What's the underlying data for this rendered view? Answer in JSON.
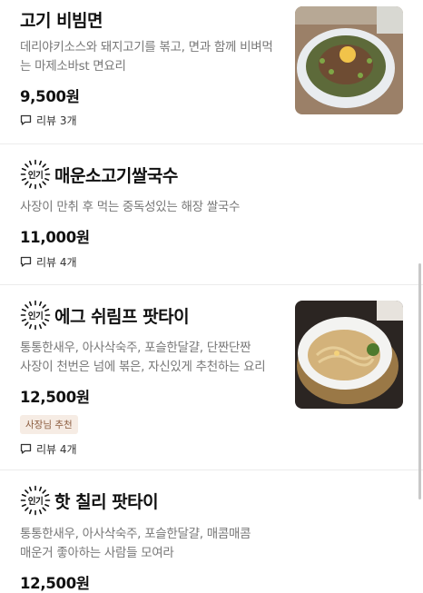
{
  "menu": [
    {
      "name": "고기 비빔면",
      "desc": [
        "데리야키소스와 돼지고기를 볶고, 면과 함께 비벼먹",
        "는 마제소바st 면요리"
      ],
      "price": "9,500원",
      "review": "리뷰 3개"
    },
    {
      "hot_badge": "인기",
      "name": "매운소고기쌀국수",
      "desc": [
        "사장이 만취 후 먹는 중독성있는 해장 쌀국수"
      ],
      "price": "11,000원",
      "review": "리뷰 4개"
    },
    {
      "hot_badge": "인기",
      "name": "에그 쉬림프 팟타이",
      "desc": [
        "통통한새우, 아사삭숙주, 포슬한달걀, 단짠단짠",
        "사장이 천번은 넘에 볶은, 자신있게 추천하는 요리"
      ],
      "price": "12,500원",
      "owner_badge": "사장님 추천",
      "review": "리뷰 4개"
    },
    {
      "hot_badge": "인기",
      "name": "핫 칠리 팟타이",
      "desc": [
        "통통한새우, 아사삭숙주, 포슬한달걀, 매콤매콤",
        "매운거 좋아하는 사람들 모여라"
      ],
      "price": "12,500원"
    }
  ],
  "icons": {
    "review": "speech-bubble-icon",
    "hot": "starburst-badge-icon"
  },
  "colors": {
    "desc": "#777777",
    "owner_badge_bg": "#f6ece4",
    "owner_badge_text": "#8a5a3c"
  }
}
